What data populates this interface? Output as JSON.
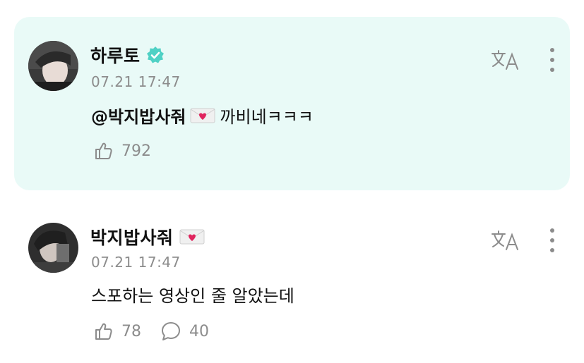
{
  "comments": [
    {
      "author": "하루토",
      "verified": true,
      "timestamp": "07.21 17:47",
      "mention": "@박지밥사줘",
      "text": "까비네ㅋㅋㅋ",
      "likes": "792",
      "highlighted": true
    },
    {
      "author": "박지밥사줘",
      "verified": false,
      "timestamp": "07.21 17:47",
      "text": "스포하는 영상인 줄 알았는데",
      "likes": "78",
      "replies": "40",
      "highlighted": false
    }
  ],
  "icons": {
    "verified": "verified-badge-icon",
    "envelope": "love-letter-icon",
    "translate": "translate-icon",
    "more": "more-options-icon",
    "like": "like-icon",
    "reply": "reply-icon"
  },
  "colors": {
    "highlight_bg": "#e9faf7",
    "verified": "#4fd1c5",
    "muted": "#8c8c8c"
  }
}
